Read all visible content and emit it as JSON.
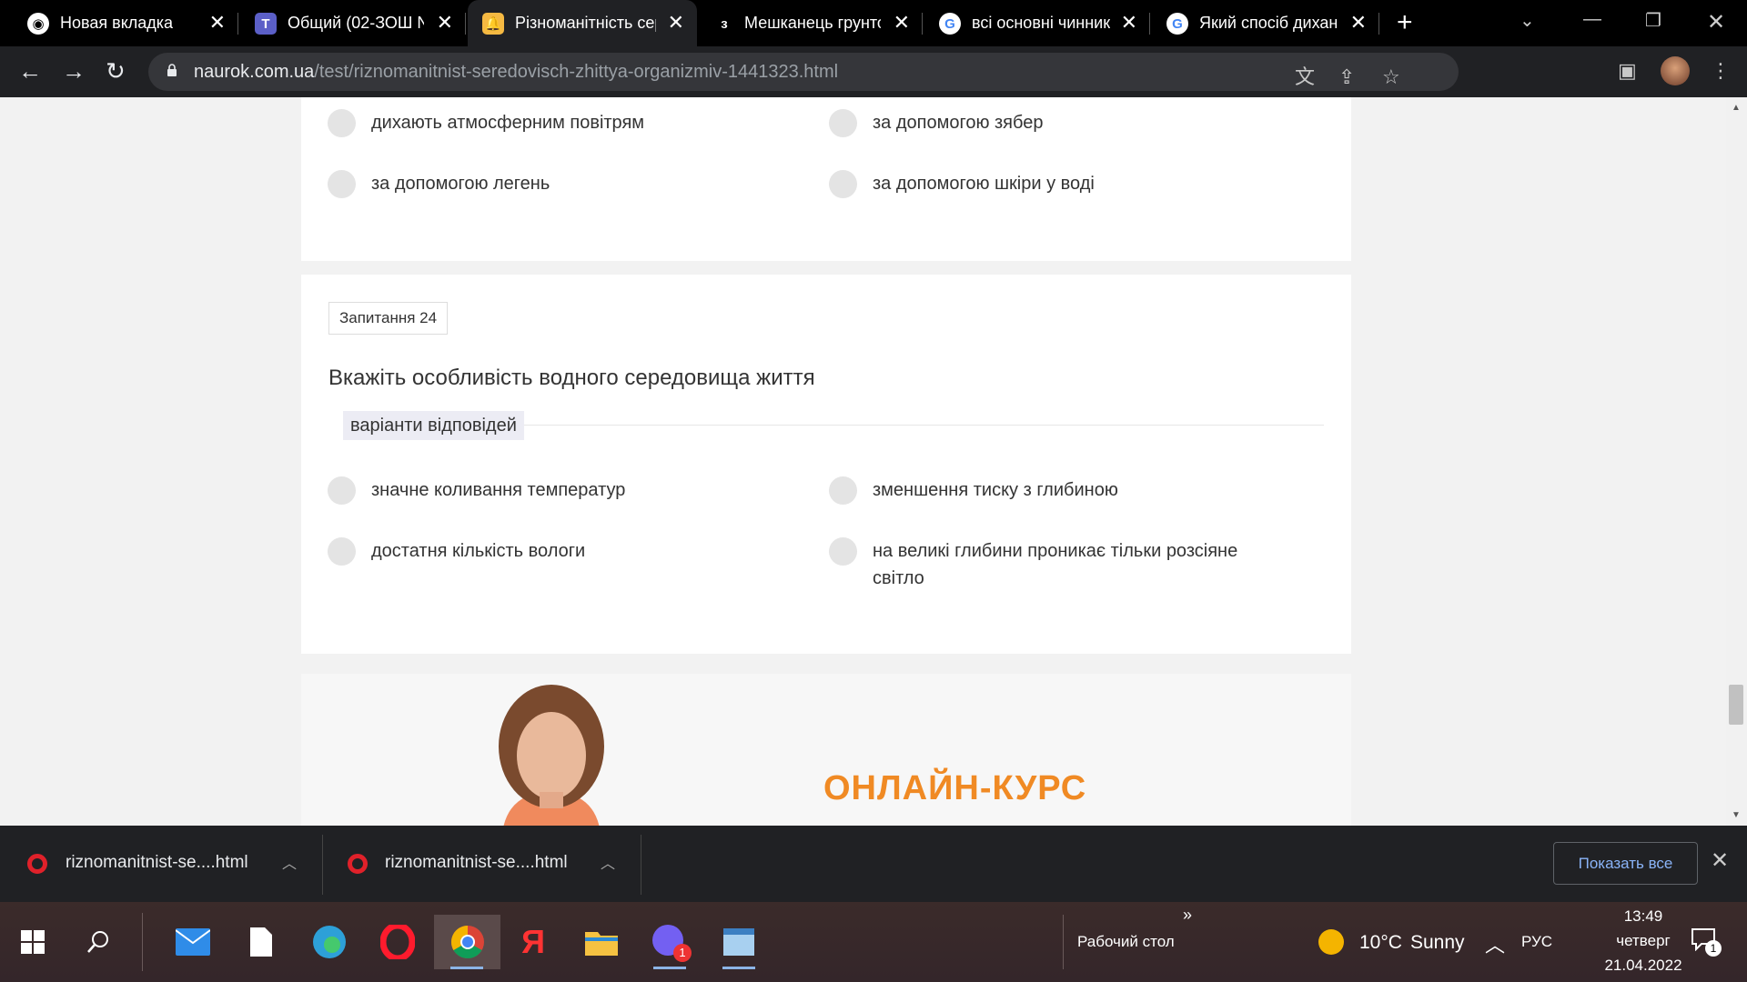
{
  "browser": {
    "tabs": [
      {
        "label": "Новая вкладка",
        "icon": "chrome-icon",
        "active": false
      },
      {
        "label": "Общий (02-ЗОШ N",
        "icon": "teams-icon",
        "active": false
      },
      {
        "label": "Різноманітність сер",
        "icon": "naurok-icon",
        "active": true
      },
      {
        "label": "Мешканець грунто",
        "icon": "z-icon",
        "active": false
      },
      {
        "label": "всі основні чинник",
        "icon": "google-icon",
        "active": false
      },
      {
        "label": "Який спосіб дихан",
        "icon": "google-icon",
        "active": false
      }
    ],
    "url_host": "naurok.com.ua",
    "url_path": "/test/riznomanitnist-seredovisch-zhittya-organizmiv-1441323.html"
  },
  "prev_question": {
    "options": [
      "дихають атмосферним повітрям",
      "за допомогою зябер",
      "за допомогою легень",
      "за допомогою шкіри у воді"
    ]
  },
  "question": {
    "badge": "Запитання 24",
    "title": "Вкажіть особливість водного середовища життя",
    "answers_label": "варіанти відповідей",
    "options": [
      "значне коливання температур",
      "зменшення тиску з глибиною",
      "достатня кількість вологи",
      "на великі глибини проникає тільки розсіяне світло"
    ]
  },
  "promo": {
    "text": "ОНЛАЙН-КУРС"
  },
  "downloads": {
    "items": [
      {
        "name": "riznomanitnist-se....html"
      },
      {
        "name": "riznomanitnist-se....html"
      }
    ],
    "show_all": "Показать все"
  },
  "taskbar": {
    "desktop_label": "Рабочий стол",
    "weather_temp": "10°C",
    "weather_text": "Sunny",
    "lang": "РУС",
    "time": "13:49",
    "day": "четверг",
    "date": "21.04.2022",
    "viber_badge": "1",
    "notif_badge": "1"
  }
}
